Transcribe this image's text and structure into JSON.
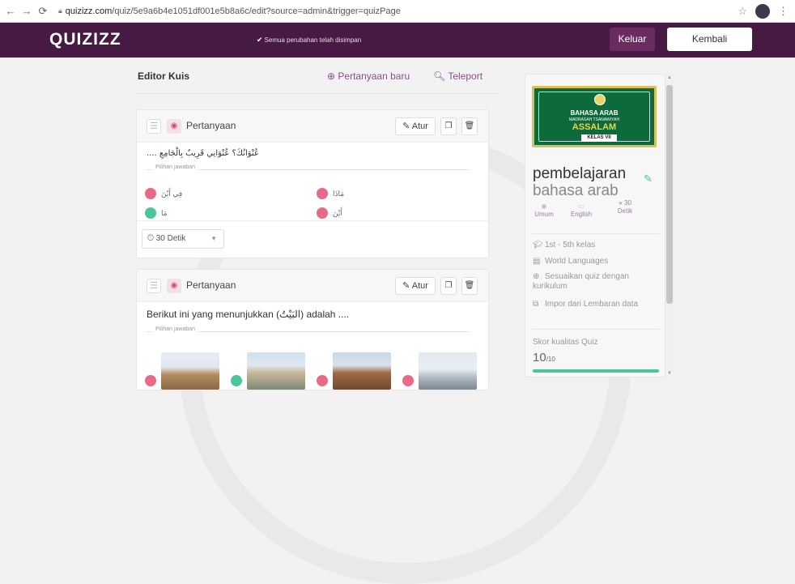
{
  "browser": {
    "url_host": "quizizz.com",
    "url_path": "/quiz/5e9a6b4e1051df001e5b8a6c/edit?source=admin&trigger=quizPage"
  },
  "topbar": {
    "logo": "QUIZIZZ",
    "saved_status": "Semua perubahan telah disimpan",
    "keluar_label": "Keluar",
    "kembali_label": "Kembali"
  },
  "editor": {
    "title": "Editor Kuis",
    "new_question": "Pertanyaan baru",
    "teleport": "Teleport"
  },
  "questions": [
    {
      "label": "Pertanyaan",
      "atur": "Atur",
      "text": ".... عُنْوَانُكَ؟ عُنْوَانِي قَرِيبٌ بِالْجَامِعِ",
      "options_label": "Pilihan jawaban",
      "answers": [
        {
          "text": "فِي أَيْنَ",
          "color": "#e86a86"
        },
        {
          "text": "مَاذَا",
          "color": "#e86a86"
        },
        {
          "text": "مَا",
          "color": "#4cc59a"
        },
        {
          "text": "أَيْنَ",
          "color": "#e86a86"
        }
      ],
      "time": "30 Detik"
    },
    {
      "label": "Pertanyaan",
      "atur": "Atur",
      "text": "Berikut ini yang menunjukkan (البَيْتُ) adalah ....",
      "options_label": "Pilihan jawaban"
    }
  ],
  "sidebar": {
    "banner": {
      "line1": "BAHASA ARAB",
      "line2": "MADRASAH TSANAWIYAH",
      "line3": "ASSALAM",
      "line4": "KELAS VII"
    },
    "title_line1": "pembelajaran",
    "title_line2": "bahasa arab",
    "meta": [
      {
        "value": "Umum",
        "icon": "eye-icon"
      },
      {
        "value": "English",
        "icon": "language-icon"
      },
      {
        "value": "30\nDetik",
        "icon": "clock-icon"
      }
    ],
    "grade": "1st - 5th kelas",
    "subject": "World Languages",
    "curriculum": "Sesuaikan quiz dengan kurikulum",
    "import": "Impor dari Lembaran data",
    "quality_label": "Skor kualitas Quiz",
    "quality_value": "10",
    "quality_max": "/10"
  }
}
